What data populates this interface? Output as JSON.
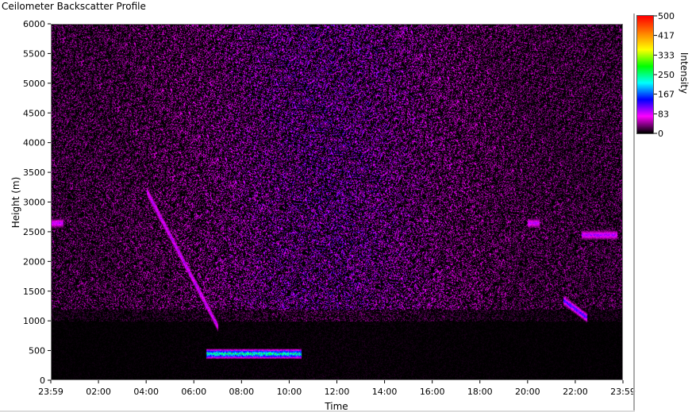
{
  "window": {
    "title": "Ceilometer Backscatter Profile"
  },
  "chart_data": {
    "type": "heatmap",
    "title": "Ceilometer Backscatter Profile",
    "xlabel": "Time",
    "ylabel": "Height (m)",
    "x_tick_labels": [
      "23:59",
      "02:00",
      "04:00",
      "06:00",
      "08:00",
      "10:00",
      "12:00",
      "14:00",
      "16:00",
      "18:00",
      "20:00",
      "22:00",
      "23:59"
    ],
    "y_ticks": [
      0,
      500,
      1000,
      1500,
      2000,
      2500,
      3000,
      3500,
      4000,
      4500,
      5000,
      5500,
      6000
    ],
    "ylim": [
      0,
      6000
    ],
    "xlim_hours": [
      0,
      24
    ],
    "colorbar": {
      "label": "Intensity",
      "ticks": [
        0,
        83,
        167,
        250,
        333,
        417,
        500
      ],
      "range": [
        0,
        500
      ],
      "colors": [
        "#000000",
        "#ff00ff",
        "#0000ff",
        "#00ffff",
        "#00ff00",
        "#ffff00",
        "#ff8000",
        "#ff0000"
      ]
    },
    "features": [
      {
        "name": "descending layer",
        "start_time": "04:00",
        "end_time": "07:00",
        "start_height_m": 3200,
        "end_height_m": 900,
        "intensity": 120
      },
      {
        "name": "boundary layer",
        "start_time": "06:30",
        "end_time": "10:30",
        "height_m": 450,
        "intensity": 300
      },
      {
        "name": "morning layer",
        "start_time": "23:59",
        "end_time": "00:30",
        "height_m": 2650,
        "intensity": 110
      },
      {
        "name": "evening layer",
        "start_time": "20:00",
        "end_time": "20:30",
        "height_m": 2650,
        "intensity": 110
      },
      {
        "name": "night layer",
        "start_time": "22:15",
        "end_time": "23:45",
        "height_m": 2450,
        "intensity": 120
      },
      {
        "name": "late descending layer",
        "start_time": "21:30",
        "end_time": "22:30",
        "start_height_m": 1350,
        "end_height_m": 1050,
        "intensity": 160
      }
    ]
  }
}
